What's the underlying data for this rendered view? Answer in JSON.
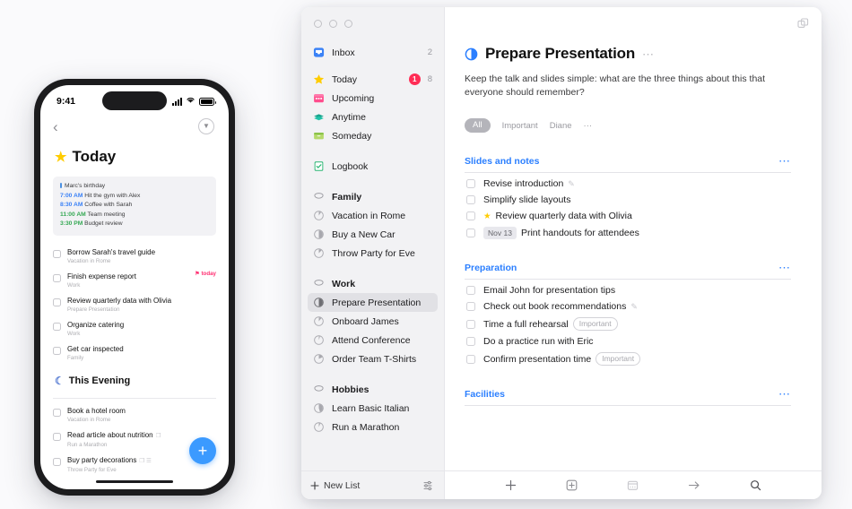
{
  "phone": {
    "status": {
      "time": "9:41",
      "signal_icon": "cellular-signal-icon",
      "wifi_icon": "wifi-icon",
      "battery_icon": "battery-icon"
    },
    "nav": {
      "back_icon": "chevron-left-icon",
      "expand_icon": "chevron-down-circle-icon"
    },
    "title": {
      "text": "Today",
      "icon": "star-icon"
    },
    "calendar": {
      "items": [
        {
          "time": "",
          "label": "Marc's birthday",
          "style": "allday"
        },
        {
          "time": "7:00 AM",
          "label": "Hit the gym with Alex",
          "style": "blue"
        },
        {
          "time": "8:30 AM",
          "label": "Coffee with Sarah",
          "style": "blue"
        },
        {
          "time": "11:00 AM",
          "label": "Team meeting",
          "style": "green"
        },
        {
          "time": "3:30 PM",
          "label": "Budget review",
          "style": "green"
        }
      ]
    },
    "tasks": [
      {
        "title": "Borrow Sarah's travel guide",
        "subtitle": "Vacation in Rome",
        "flag": "",
        "icons": ""
      },
      {
        "title": "Finish expense report",
        "subtitle": "Work",
        "flag": "today",
        "icons": ""
      },
      {
        "title": "Review quarterly data with Olivia",
        "subtitle": "Prepare Presentation",
        "flag": "",
        "icons": ""
      },
      {
        "title": "Organize catering",
        "subtitle": "Work",
        "flag": "",
        "icons": ""
      },
      {
        "title": "Get car inspected",
        "subtitle": "Family",
        "flag": "",
        "icons": ""
      }
    ],
    "evening": {
      "title": "This Evening",
      "icon": "moon-icon"
    },
    "evening_tasks": [
      {
        "title": "Book a hotel room",
        "subtitle": "Vacation in Rome",
        "icons": ""
      },
      {
        "title": "Read article about nutrition",
        "subtitle": "Run a Marathon",
        "icons": "❐"
      },
      {
        "title": "Buy party decorations",
        "subtitle": "Throw Party for Eve",
        "icons": "❐ ☰"
      }
    ],
    "fab": {
      "label": "+",
      "icon": "plus-icon",
      "color": "#3b9aff"
    }
  },
  "window": {
    "traffic_lights": [
      "close",
      "minimize",
      "zoom"
    ],
    "top_right_icon": "duplicate-window-icon",
    "sidebar": {
      "items": [
        {
          "label": "Inbox",
          "icon": "inbox-icon",
          "count": "2",
          "badge": "",
          "type": "list"
        },
        {
          "label": "Today",
          "icon": "star-icon",
          "count": "8",
          "badge": "1",
          "type": "list"
        },
        {
          "label": "Upcoming",
          "icon": "calendar-icon",
          "count": "",
          "badge": "",
          "type": "list"
        },
        {
          "label": "Anytime",
          "icon": "layers-icon",
          "count": "",
          "badge": "",
          "type": "list"
        },
        {
          "label": "Someday",
          "icon": "box-icon",
          "count": "",
          "badge": "",
          "type": "list"
        },
        {
          "label": "Logbook",
          "icon": "logbook-icon",
          "count": "",
          "badge": "",
          "type": "list",
          "gap_before": true
        },
        {
          "label": "Family",
          "icon": "area-icon",
          "count": "",
          "badge": "",
          "type": "area",
          "gap_before": true
        },
        {
          "label": "Vacation in Rome",
          "icon": "progress-icon",
          "progress": 0.15,
          "type": "project"
        },
        {
          "label": "Buy a New Car",
          "icon": "progress-icon",
          "progress": 0.5,
          "type": "project"
        },
        {
          "label": "Throw Party for Eve",
          "icon": "progress-icon",
          "progress": 0.25,
          "type": "project"
        },
        {
          "label": "Work",
          "icon": "area-icon",
          "type": "area",
          "gap_before": true
        },
        {
          "label": "Prepare Presentation",
          "icon": "progress-icon",
          "progress": 0.5,
          "type": "project",
          "selected": true
        },
        {
          "label": "Onboard James",
          "icon": "progress-icon",
          "progress": 0.2,
          "type": "project"
        },
        {
          "label": "Attend Conference",
          "icon": "progress-icon",
          "progress": 0.08,
          "type": "project"
        },
        {
          "label": "Order Team T-Shirts",
          "icon": "progress-icon",
          "progress": 0.3,
          "type": "project"
        },
        {
          "label": "Hobbies",
          "icon": "area-icon",
          "type": "area",
          "gap_before": true
        },
        {
          "label": "Learn Basic Italian",
          "icon": "progress-icon",
          "progress": 0.45,
          "type": "project"
        },
        {
          "label": "Run a Marathon",
          "icon": "progress-icon",
          "progress": 0.1,
          "type": "project"
        }
      ],
      "footer": {
        "new_list_label": "New List",
        "new_list_icon": "plus-icon",
        "settings_icon": "sliders-icon"
      }
    },
    "project": {
      "title": "Prepare Presentation",
      "title_icon": "progress-half-icon",
      "title_menu_icon": "ellipsis-icon",
      "description": "Keep the talk and slides simple: what are the three things about this that everyone should remember?",
      "filters": [
        {
          "label": "All",
          "active": true
        },
        {
          "label": "Important",
          "active": false
        },
        {
          "label": "Diane",
          "active": false
        },
        {
          "label": "···",
          "active": false
        }
      ],
      "sections": [
        {
          "title": "Slides and notes",
          "menu_icon": "ellipsis-icon",
          "tasks": [
            {
              "title": "Revise introduction",
              "star": false,
              "date": "",
              "tag": "",
              "note": true
            },
            {
              "title": "Simplify slide layouts",
              "star": false,
              "date": "",
              "tag": "",
              "note": false
            },
            {
              "title": "Review quarterly data with Olivia",
              "star": true,
              "date": "",
              "tag": "",
              "note": false
            },
            {
              "title": "Print handouts for attendees",
              "star": false,
              "date": "Nov 13",
              "tag": "",
              "note": false
            }
          ]
        },
        {
          "title": "Preparation",
          "menu_icon": "ellipsis-icon",
          "tasks": [
            {
              "title": "Email John for presentation tips",
              "star": false,
              "date": "",
              "tag": "",
              "note": false
            },
            {
              "title": "Check out book recommendations",
              "star": false,
              "date": "",
              "tag": "",
              "note": true
            },
            {
              "title": "Time a full rehearsal",
              "star": false,
              "date": "",
              "tag": "Important",
              "note": false
            },
            {
              "title": "Do a practice run with Eric",
              "star": false,
              "date": "",
              "tag": "",
              "note": false
            },
            {
              "title": "Confirm presentation time",
              "star": false,
              "date": "",
              "tag": "Important",
              "note": false
            }
          ]
        },
        {
          "title": "Facilities",
          "menu_icon": "ellipsis-icon",
          "tasks": []
        }
      ]
    },
    "toolbar": {
      "buttons": [
        {
          "icon": "plus-icon",
          "name": "new-todo-button"
        },
        {
          "icon": "plus-box-icon",
          "name": "new-heading-button"
        },
        {
          "icon": "calendar-icon",
          "name": "when-button"
        },
        {
          "icon": "arrow-right-icon",
          "name": "move-button"
        },
        {
          "icon": "search-icon",
          "name": "search-button"
        }
      ]
    }
  },
  "colors": {
    "accent_blue": "#2b7fff",
    "star_yellow": "#ffcc00",
    "badge_red": "#ff2d55",
    "fab_blue": "#3b9aff"
  }
}
